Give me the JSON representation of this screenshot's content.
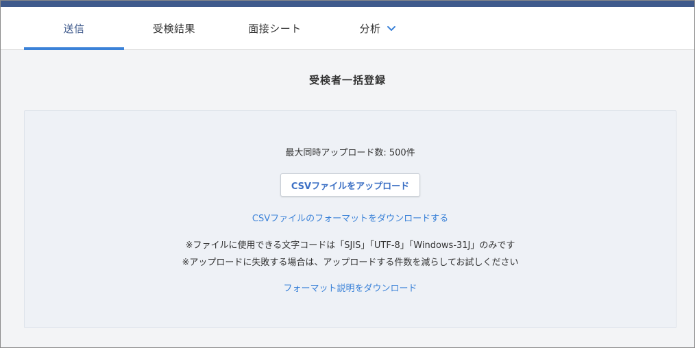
{
  "tabs": [
    {
      "label": "送信",
      "active": true
    },
    {
      "label": "受検結果",
      "active": false
    },
    {
      "label": "面接シート",
      "active": false
    },
    {
      "label": "分析",
      "active": false,
      "has_dropdown": true
    }
  ],
  "page_title": "受検者一括登録",
  "panel": {
    "max_upload_text": "最大同時アップロード数: 500件",
    "upload_button_label": "CSVファイルをアップロード",
    "format_download_link": "CSVファイルのフォーマットをダウンロードする",
    "note_encoding": "※ファイルに使用できる文字コードは「SJIS」「UTF-8」「Windows-31J」のみです",
    "note_failure": "※アップロードに失敗する場合は、アップロードする件数を減らしてお試しください",
    "description_download_link": "フォーマット説明をダウンロード"
  },
  "icons": {
    "dropdown": "chevron-down-icon"
  },
  "colors": {
    "topbar": "#3f5a8c",
    "active_tab_underline": "#3b82d8",
    "link": "#3b82d8",
    "button_text": "#3b6fc4",
    "panel_background": "#eef1f6",
    "page_background": "#f3f4f6"
  }
}
